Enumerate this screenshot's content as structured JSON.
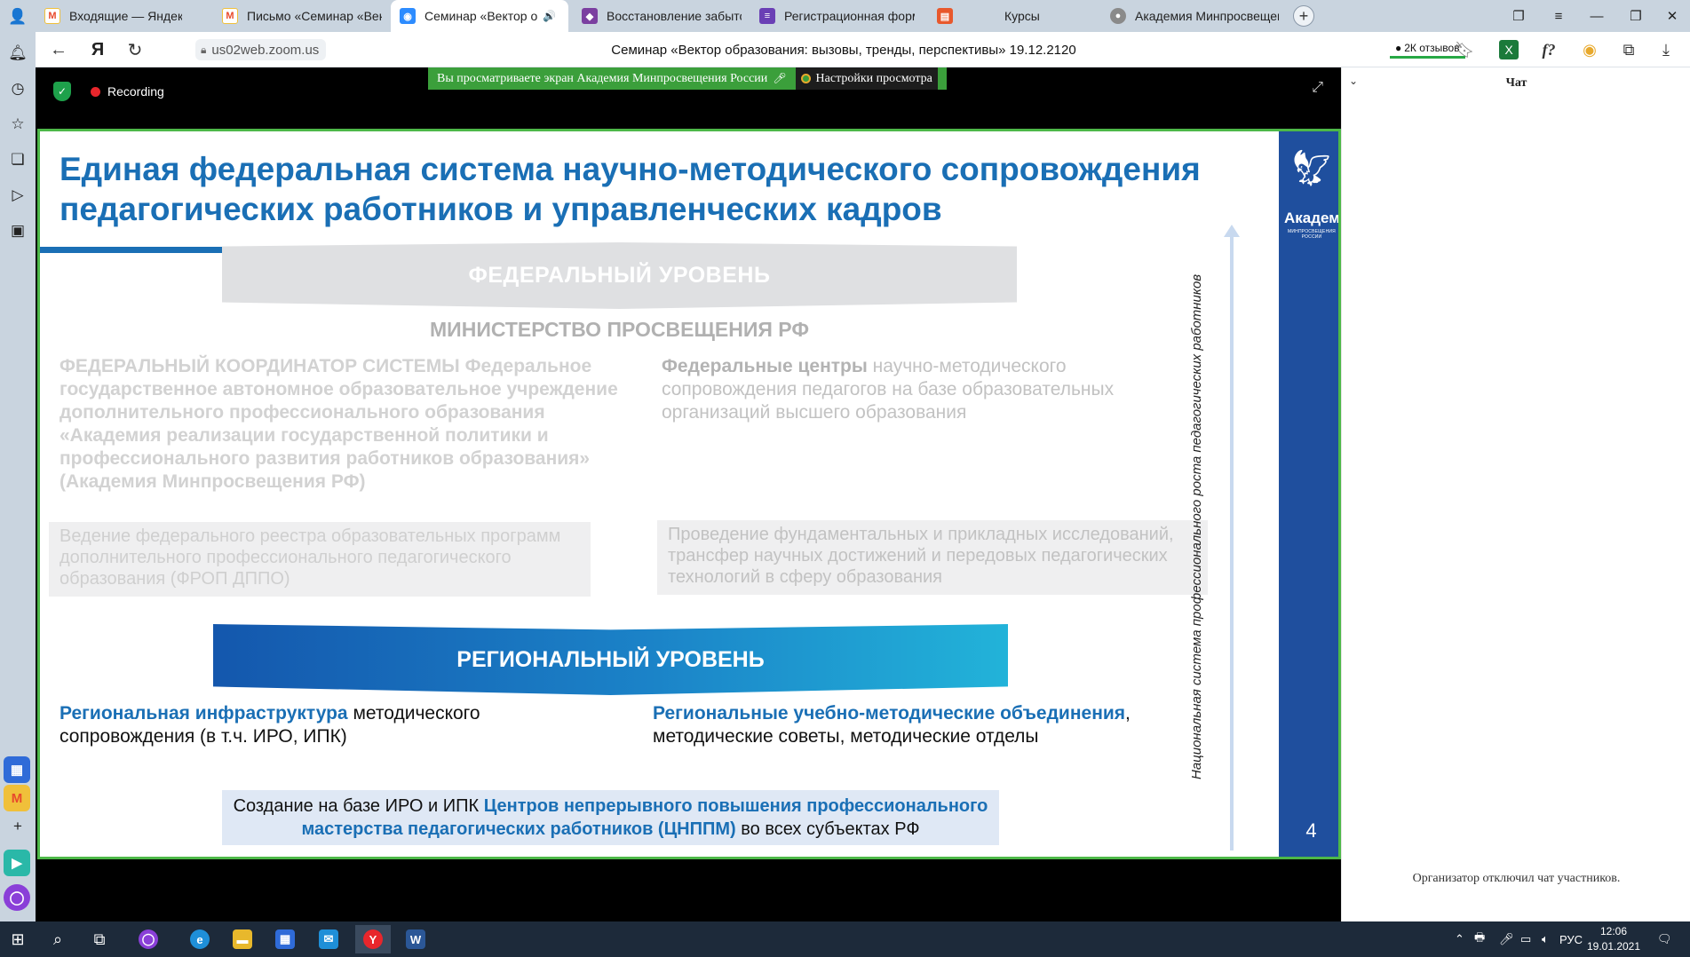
{
  "browser": {
    "tabs": [
      {
        "label": "Входящие — Яндекс.Почт",
        "icon": "mail-icon"
      },
      {
        "label": "Письмо «Семинар «Векто",
        "icon": "mail-icon"
      },
      {
        "label": "Семинар «Вектор о",
        "icon": "zoom-icon",
        "active": true
      },
      {
        "label": "Восстановление забытог",
        "icon": "shield-icon"
      },
      {
        "label": "Регистрационная форма",
        "icon": "form-icon"
      },
      {
        "label": "Курсы",
        "icon": "courses-icon"
      },
      {
        "label": "Академия Минпросвещен",
        "icon": "academy-icon"
      }
    ],
    "url": "us02web.zoom.us",
    "page_title": "Семинар «Вектор образования: вызовы, тренды, перспективы» 19.12.2120",
    "reviews_label": "2К отзывов",
    "yandex_button": "Я"
  },
  "zoom": {
    "recording_label": "Recording",
    "share_banner": "Вы просматриваете экран Академия Минпросвещения России",
    "view_options": "Настройки просмотра"
  },
  "slide": {
    "title": "Единая федеральная система научно-методического сопровождения педагогических работников и управленческих кадров",
    "federal_level": "ФЕДЕРАЛЬНЫЙ УРОВЕНЬ",
    "ministry": "МИНИСТЕРСТВО ПРОСВЕЩЕНИЯ РФ",
    "federal_coordinator": "ФЕДЕРАЛЬНЫЙ КООРДИНАТОР СИСТЕМЫ Федеральное государственное автономное образовательное учреждение дополнительного профессионального образования «Академия реализации государственной политики и профессионального развития работников образования» (Академия Минпросвещения РФ)",
    "federal_centers_bold": "Федеральные центры",
    "federal_centers_rest": " научно-методического сопровождения педагогов на базе образовательных организаций высшего образования",
    "box_left": "Ведение федерального реестра образовательных программ дополнительного профессионального педагогического образования (ФРОП ДППО)",
    "box_right": "Проведение фундаментальных и прикладных исследований, трансфер научных достижений и передовых педагогических технологий в сферу образования",
    "regional_level": "РЕГИОНАЛЬНЫЙ УРОВЕНЬ",
    "regional_infra_bold": "Региональная инфраструктура",
    "regional_infra_rest": " методического сопровождения (в т.ч. ИРО, ИПК)",
    "regional_umo_bold": "Региональные учебно-методические объединения",
    "regional_umo_rest": ", методические советы, методические отделы",
    "center_box_pre": "Создание на базе ИРО и ИПК ",
    "center_box_bold": "Центров непрерывного повышения профессионального мастерства педагогических работников (ЦНППМ)",
    "center_box_post": " во всех субъектах РФ",
    "vertical_label": "Национальная система профессионального роста педагогических работников",
    "logo_text": "АкадемиЯ",
    "logo_sub": "МИНПРОСВЕЩЕНИЯ РОССИИ",
    "page_number": "4"
  },
  "chat": {
    "title": "Чат",
    "message": "Организатор отключил чат участников."
  },
  "taskbar": {
    "language": "РУС",
    "time": "12:06",
    "date": "19.01.2021"
  },
  "colors": {
    "title_blue": "#1a6fb5",
    "zoom_green": "#4db848",
    "recording_red": "#e8262c",
    "slide_sidebar": "#1f4f9e"
  }
}
